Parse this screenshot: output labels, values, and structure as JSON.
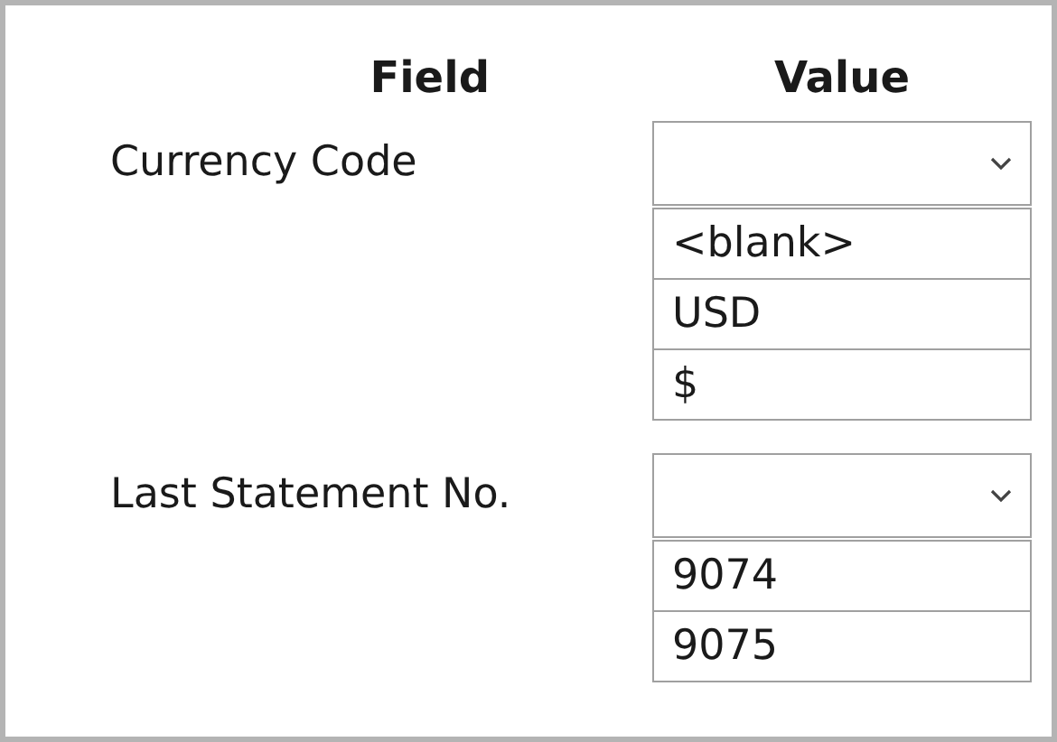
{
  "columns": [
    "Field",
    "Value"
  ],
  "rows": [
    {
      "label": "Currency Code",
      "options": [
        "<blank>",
        "USD",
        "$"
      ]
    },
    {
      "label": "Last Statement No.",
      "options": [
        "9074",
        "9075"
      ]
    }
  ]
}
